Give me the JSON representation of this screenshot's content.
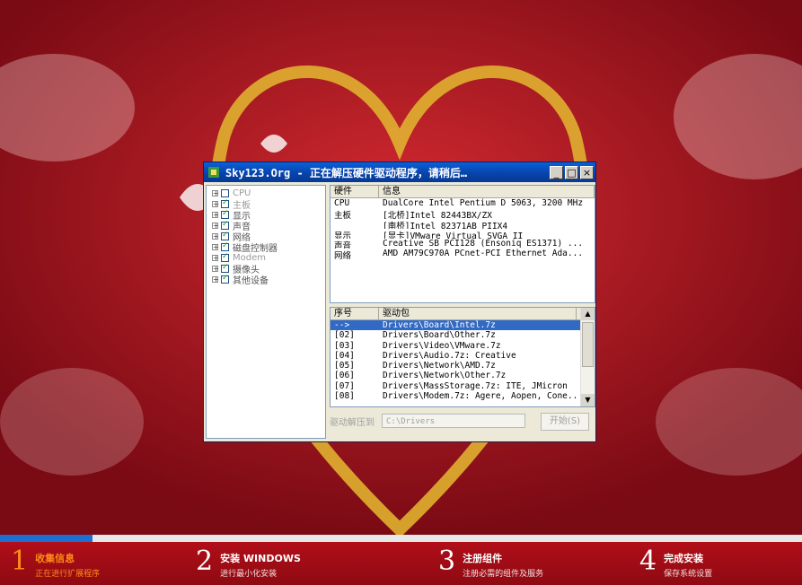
{
  "window": {
    "title": "Sky123.Org - 正在解压硬件驱动程序，请稍后…",
    "minimize_label": "_",
    "maximize_label": "□",
    "close_label": "×"
  },
  "tree": {
    "items": [
      {
        "label": "CPU",
        "checked": false,
        "dim": true
      },
      {
        "label": "主板",
        "checked": true,
        "dim": true
      },
      {
        "label": "显示",
        "checked": true,
        "dim": false
      },
      {
        "label": "声音",
        "checked": true,
        "dim": false
      },
      {
        "label": "网络",
        "checked": true,
        "dim": false
      },
      {
        "label": "磁盘控制器",
        "checked": true,
        "dim": false
      },
      {
        "label": "Modem",
        "checked": true,
        "dim": true
      },
      {
        "label": "摄像头",
        "checked": true,
        "dim": false
      },
      {
        "label": "其他设备",
        "checked": true,
        "dim": false
      }
    ]
  },
  "hardware": {
    "headers": [
      "硬件",
      "信息"
    ],
    "rows": [
      [
        "CPU",
        "DualCore Intel Pentium D 5063, 3200 MHz"
      ],
      [
        "主板",
        "[北桥]Intel 82443BX/ZX"
      ],
      [
        "",
        "[南桥]Intel 82371AB PIIX4"
      ],
      [
        "显示",
        "[显卡]VMware Virtual SVGA II"
      ],
      [
        "声音",
        "Creative SB PCI128 (Ensoniq ES1371) ..."
      ],
      [
        "网络",
        "AMD AM79C970A PCnet-PCI Ethernet Ada..."
      ]
    ]
  },
  "drivers": {
    "headers": [
      "序号",
      "驱动包"
    ],
    "rows": [
      [
        "-->",
        "Drivers\\Board\\Intel.7z"
      ],
      [
        "[02]",
        "Drivers\\Board\\Other.7z"
      ],
      [
        "[03]",
        "Drivers\\Video\\VMware.7z"
      ],
      [
        "[04]",
        "Drivers\\Audio.7z: Creative"
      ],
      [
        "[05]",
        "Drivers\\Network\\AMD.7z"
      ],
      [
        "[06]",
        "Drivers\\Network\\Other.7z"
      ],
      [
        "[07]",
        "Drivers\\MassStorage.7z: ITE, JMicron"
      ],
      [
        "[08]",
        "Drivers\\Modem.7z: Agere, Aopen, Cone..."
      ]
    ]
  },
  "extract": {
    "label": "驱动解压到",
    "path": "C:\\Drivers",
    "start_label": "开始(S)"
  },
  "progress": {
    "fraction": 0.115
  },
  "steps": [
    {
      "num": "1",
      "title": "收集信息",
      "sub": "正在进行扩展程序",
      "active": true
    },
    {
      "num": "2",
      "title": "安装 WINDOWS",
      "sub": "进行最小化安装",
      "active": false
    },
    {
      "num": "3",
      "title": "注册组件",
      "sub": "注册必需的组件及服务",
      "active": false
    },
    {
      "num": "4",
      "title": "完成安装",
      "sub": "保存系统设置",
      "active": false
    }
  ],
  "colors": {
    "accent": "#ff8c1a",
    "titlebar": "#0a5fd8",
    "background": "#b5121d"
  }
}
